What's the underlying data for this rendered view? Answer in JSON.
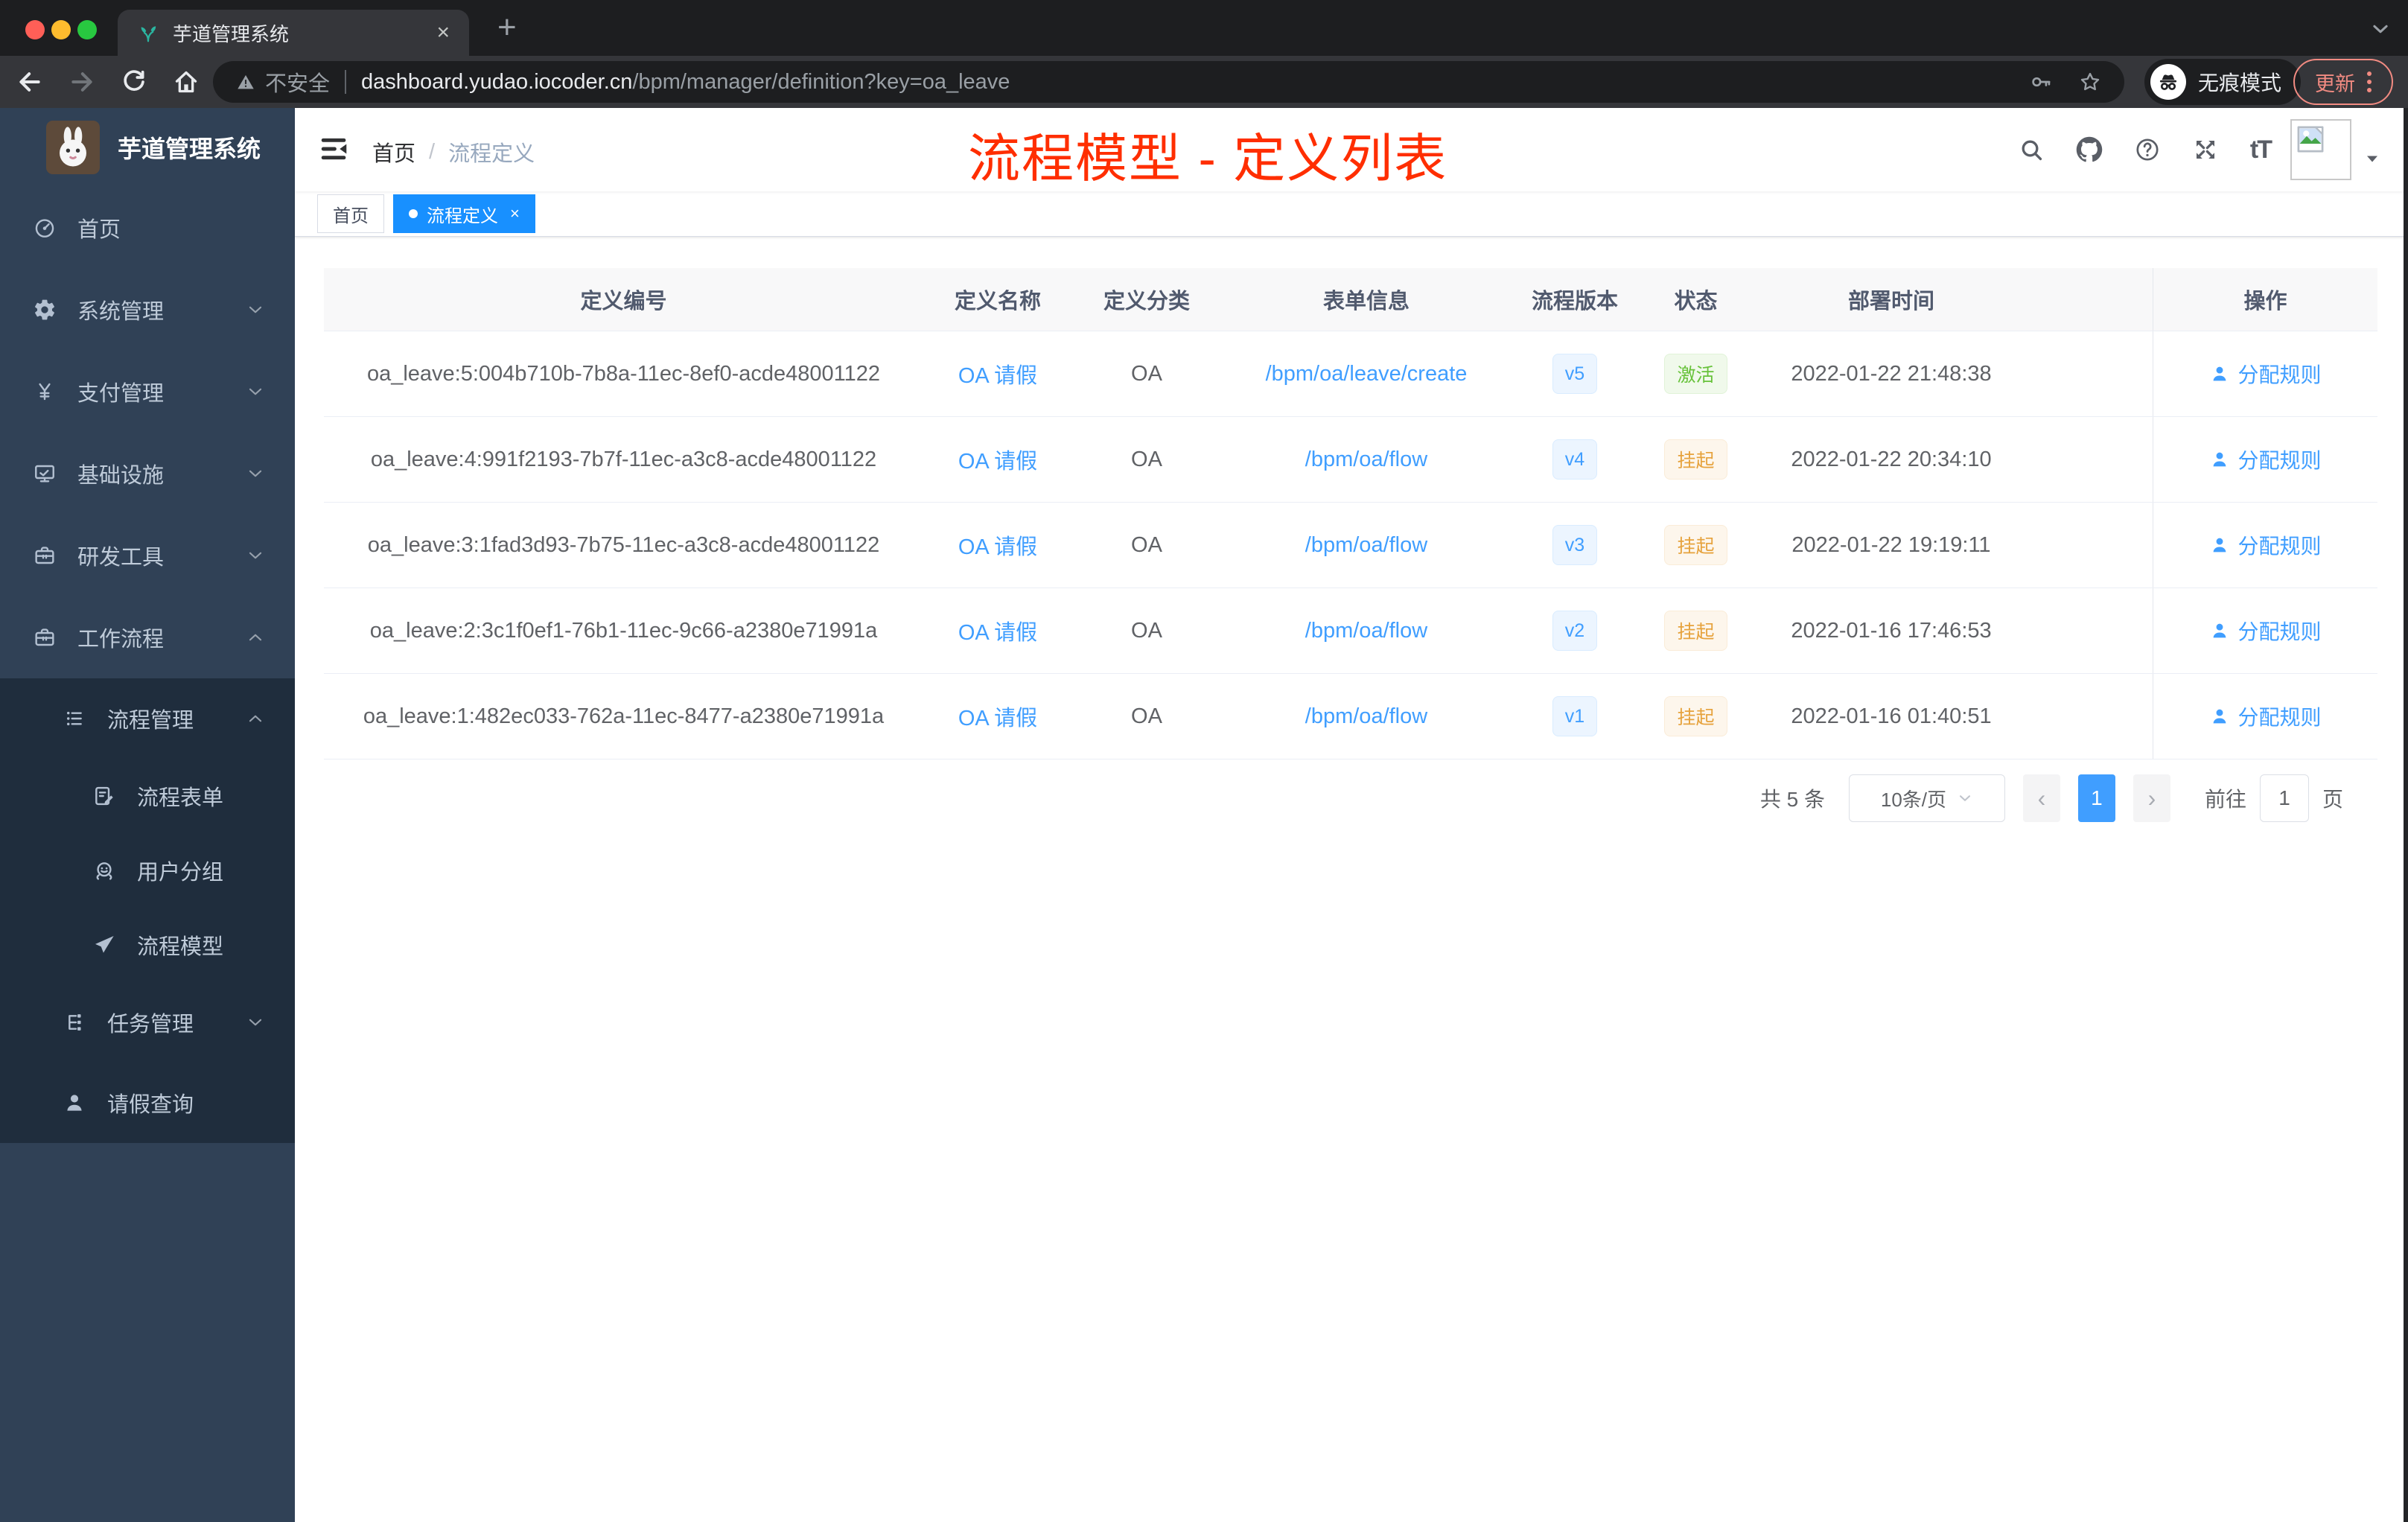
{
  "browser": {
    "tab": {
      "title": "芋道管理系统",
      "close_glyph": "×"
    },
    "new_tab_glyph": "+",
    "security_label": "不安全",
    "url_host": "dashboard.yudao.iocoder.cn",
    "url_path": "/bpm/manager/definition?key=oa_leave",
    "incognito_label": "无痕模式",
    "update_label": "更新"
  },
  "sidebar": {
    "logo_title": "芋道管理系统",
    "items": [
      {
        "name": "home",
        "label": "首页",
        "icon": "dashboard",
        "level": 0,
        "chevron": null,
        "dark": false
      },
      {
        "name": "system-management",
        "label": "系统管理",
        "icon": "gear",
        "level": 0,
        "chevron": "down",
        "dark": false
      },
      {
        "name": "payment-management",
        "label": "支付管理",
        "icon": "yen",
        "level": 0,
        "chevron": "down",
        "dark": false
      },
      {
        "name": "infrastructure",
        "label": "基础设施",
        "icon": "monitor",
        "level": 0,
        "chevron": "down",
        "dark": false
      },
      {
        "name": "dev-tools",
        "label": "研发工具",
        "icon": "toolbox",
        "level": 0,
        "chevron": "down",
        "dark": false
      },
      {
        "name": "workflow",
        "label": "工作流程",
        "icon": "briefcase",
        "level": 0,
        "chevron": "up",
        "dark": false
      },
      {
        "name": "process-management",
        "label": "流程管理",
        "icon": "list",
        "level": 1,
        "chevron": "up",
        "dark": true
      },
      {
        "name": "process-form",
        "label": "流程表单",
        "icon": "form",
        "level": 2,
        "chevron": null,
        "dark": true
      },
      {
        "name": "user-group",
        "label": "用户分组",
        "icon": "robot",
        "level": 2,
        "chevron": null,
        "dark": true
      },
      {
        "name": "process-model",
        "label": "流程模型",
        "icon": "send",
        "level": 2,
        "chevron": null,
        "dark": true
      },
      {
        "name": "task-management",
        "label": "任务管理",
        "icon": "flow",
        "level": 1,
        "chevron": "down",
        "dark": true
      },
      {
        "name": "leave-query",
        "label": "请假查询",
        "icon": "user",
        "level": 1,
        "chevron": null,
        "dark": true
      }
    ]
  },
  "header": {
    "breadcrumb": {
      "home": "首页",
      "separator": "/",
      "current": "流程定义"
    },
    "annotation": "流程模型 - 定义列表"
  },
  "tags": [
    {
      "name": "tag-home",
      "label": "首页",
      "active": false
    },
    {
      "name": "tag-process-definition",
      "label": "流程定义",
      "active": true
    }
  ],
  "table": {
    "columns": [
      "定义编号",
      "定义名称",
      "定义分类",
      "表单信息",
      "流程版本",
      "状态",
      "部署时间",
      "操作"
    ],
    "rows": [
      {
        "id": "oa_leave:5:004b710b-7b8a-11ec-8ef0-acde48001122",
        "name": "OA 请假",
        "category": "OA",
        "form": "/bpm/oa/leave/create",
        "version": "v5",
        "status": "激活",
        "status_type": "success",
        "time": "2022-01-22 21:48:38",
        "action": "分配规则"
      },
      {
        "id": "oa_leave:4:991f2193-7b7f-11ec-a3c8-acde48001122",
        "name": "OA 请假",
        "category": "OA",
        "form": "/bpm/oa/flow",
        "version": "v4",
        "status": "挂起",
        "status_type": "warning",
        "time": "2022-01-22 20:34:10",
        "action": "分配规则"
      },
      {
        "id": "oa_leave:3:1fad3d93-7b75-11ec-a3c8-acde48001122",
        "name": "OA 请假",
        "category": "OA",
        "form": "/bpm/oa/flow",
        "version": "v3",
        "status": "挂起",
        "status_type": "warning",
        "time": "2022-01-22 19:19:11",
        "action": "分配规则"
      },
      {
        "id": "oa_leave:2:3c1f0ef1-76b1-11ec-9c66-a2380e71991a",
        "name": "OA 请假",
        "category": "OA",
        "form": "/bpm/oa/flow",
        "version": "v2",
        "status": "挂起",
        "status_type": "warning",
        "time": "2022-01-16 17:46:53",
        "action": "分配规则"
      },
      {
        "id": "oa_leave:1:482ec033-762a-11ec-8477-a2380e71991a",
        "name": "OA 请假",
        "category": "OA",
        "form": "/bpm/oa/flow",
        "version": "v1",
        "status": "挂起",
        "status_type": "warning",
        "time": "2022-01-16 01:40:51",
        "action": "分配规则"
      }
    ]
  },
  "pagination": {
    "total": "共 5 条",
    "page_size": "10条/页",
    "prev_glyph": "‹",
    "current_page": "1",
    "next_glyph": "›",
    "goto_label": "前往",
    "goto_value": "1",
    "unit_label": "页"
  },
  "colors": {
    "accent_blue": "#409eff",
    "tag_active_blue": "#1890ff",
    "success_green": "#67c23a",
    "warning_orange": "#e6a23c",
    "annotation_red": "#ff2e00",
    "sidebar_bg": "#304156",
    "submenu_bg": "#1f2d3d"
  }
}
